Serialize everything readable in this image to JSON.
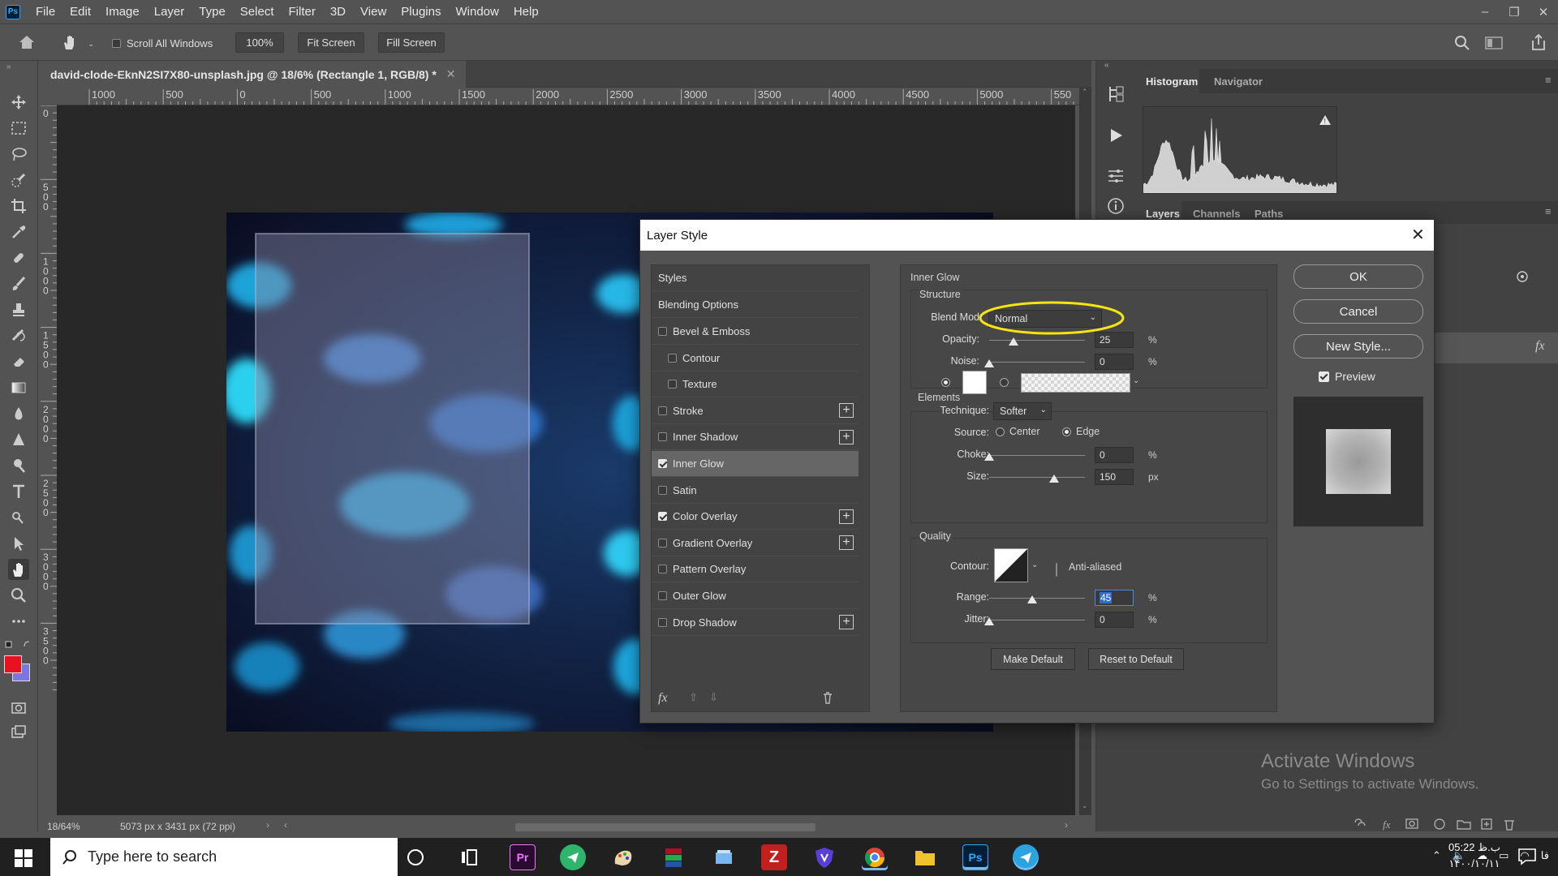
{
  "menubar": {
    "logo": "Ps",
    "items": [
      "File",
      "Edit",
      "Image",
      "Layer",
      "Type",
      "Select",
      "Filter",
      "3D",
      "View",
      "Plugins",
      "Window",
      "Help"
    ]
  },
  "options": {
    "scroll_all_windows": "Scroll All Windows",
    "zoom": "100%",
    "fit_screen": "Fit Screen",
    "fill_screen": "Fill Screen"
  },
  "document": {
    "tab_title": "david-clode-EknN2SI7X80-unsplash.jpg @ 18/6% (Rectangle 1, RGB/8) *",
    "ruler_h": [
      "1000",
      "500",
      "0",
      "500",
      "1000",
      "1500",
      "2000",
      "2500",
      "3000",
      "3500",
      "4000",
      "4500",
      "5000",
      "550"
    ],
    "ruler_v": [
      "0",
      "500",
      "1000",
      "1500",
      "2000",
      "2500",
      "3000",
      "3500"
    ],
    "status_zoom": "18/64%",
    "status_info": "5073 px x 3431 px (72 ppi)"
  },
  "panels": {
    "top_tabs": [
      "Histogram",
      "Navigator"
    ],
    "layer_tabs": [
      "Layers",
      "Channels",
      "Paths"
    ]
  },
  "watermark": {
    "title": "Activate Windows",
    "subtitle": "Go to Settings to activate Windows."
  },
  "dialog": {
    "title": "Layer Style",
    "styles_header": "Styles",
    "blending_options": "Blending Options",
    "effects": [
      {
        "label": "Bevel & Emboss",
        "checked": false,
        "plus": false,
        "indent": false
      },
      {
        "label": "Contour",
        "checked": false,
        "plus": false,
        "indent": true
      },
      {
        "label": "Texture",
        "checked": false,
        "plus": false,
        "indent": true
      },
      {
        "label": "Stroke",
        "checked": false,
        "plus": true,
        "indent": false
      },
      {
        "label": "Inner Shadow",
        "checked": false,
        "plus": true,
        "indent": false
      },
      {
        "label": "Inner Glow",
        "checked": true,
        "plus": false,
        "indent": false,
        "selected": true
      },
      {
        "label": "Satin",
        "checked": false,
        "plus": false,
        "indent": false
      },
      {
        "label": "Color Overlay",
        "checked": true,
        "plus": true,
        "indent": false
      },
      {
        "label": "Gradient Overlay",
        "checked": false,
        "plus": true,
        "indent": false
      },
      {
        "label": "Pattern Overlay",
        "checked": false,
        "plus": false,
        "indent": false
      },
      {
        "label": "Outer Glow",
        "checked": false,
        "plus": false,
        "indent": false
      },
      {
        "label": "Drop Shadow",
        "checked": false,
        "plus": true,
        "indent": false
      }
    ],
    "fx_label": "fx",
    "inner_glow": {
      "section_title": "Inner Glow",
      "structure_title": "Structure",
      "blend_mode_label": "Blend Mod",
      "blend_mode_value": "Normal",
      "opacity_label": "Opacity:",
      "opacity_value": "25",
      "noise_label": "Noise:",
      "noise_value": "0",
      "percent": "%",
      "px": "px",
      "elements_title": "Elements",
      "technique_label": "Technique:",
      "technique_value": "Softer",
      "source_label": "Source:",
      "source_center": "Center",
      "source_edge": "Edge",
      "choke_label": "Choke:",
      "choke_value": "0",
      "size_label": "Size:",
      "size_value": "150",
      "quality_title": "Quality",
      "contour_label": "Contour:",
      "anti_aliased": "Anti-aliased",
      "range_label": "Range:",
      "range_value": "45",
      "jitter_label": "Jitter:",
      "jitter_value": "0",
      "make_default": "Make Default",
      "reset_default": "Reset to Default"
    },
    "buttons": {
      "ok": "OK",
      "cancel": "Cancel",
      "new_style": "New Style...",
      "preview": "Preview"
    },
    "highlight_color": "#f5e60f"
  },
  "taskbar": {
    "search_placeholder": "Type here to search",
    "apps": [
      "Pr",
      "Ps"
    ],
    "clock_time": "05:22 ب.ظ",
    "clock_date": "۱۴۰۰/۱۰/۱۱",
    "lang": "فا"
  }
}
